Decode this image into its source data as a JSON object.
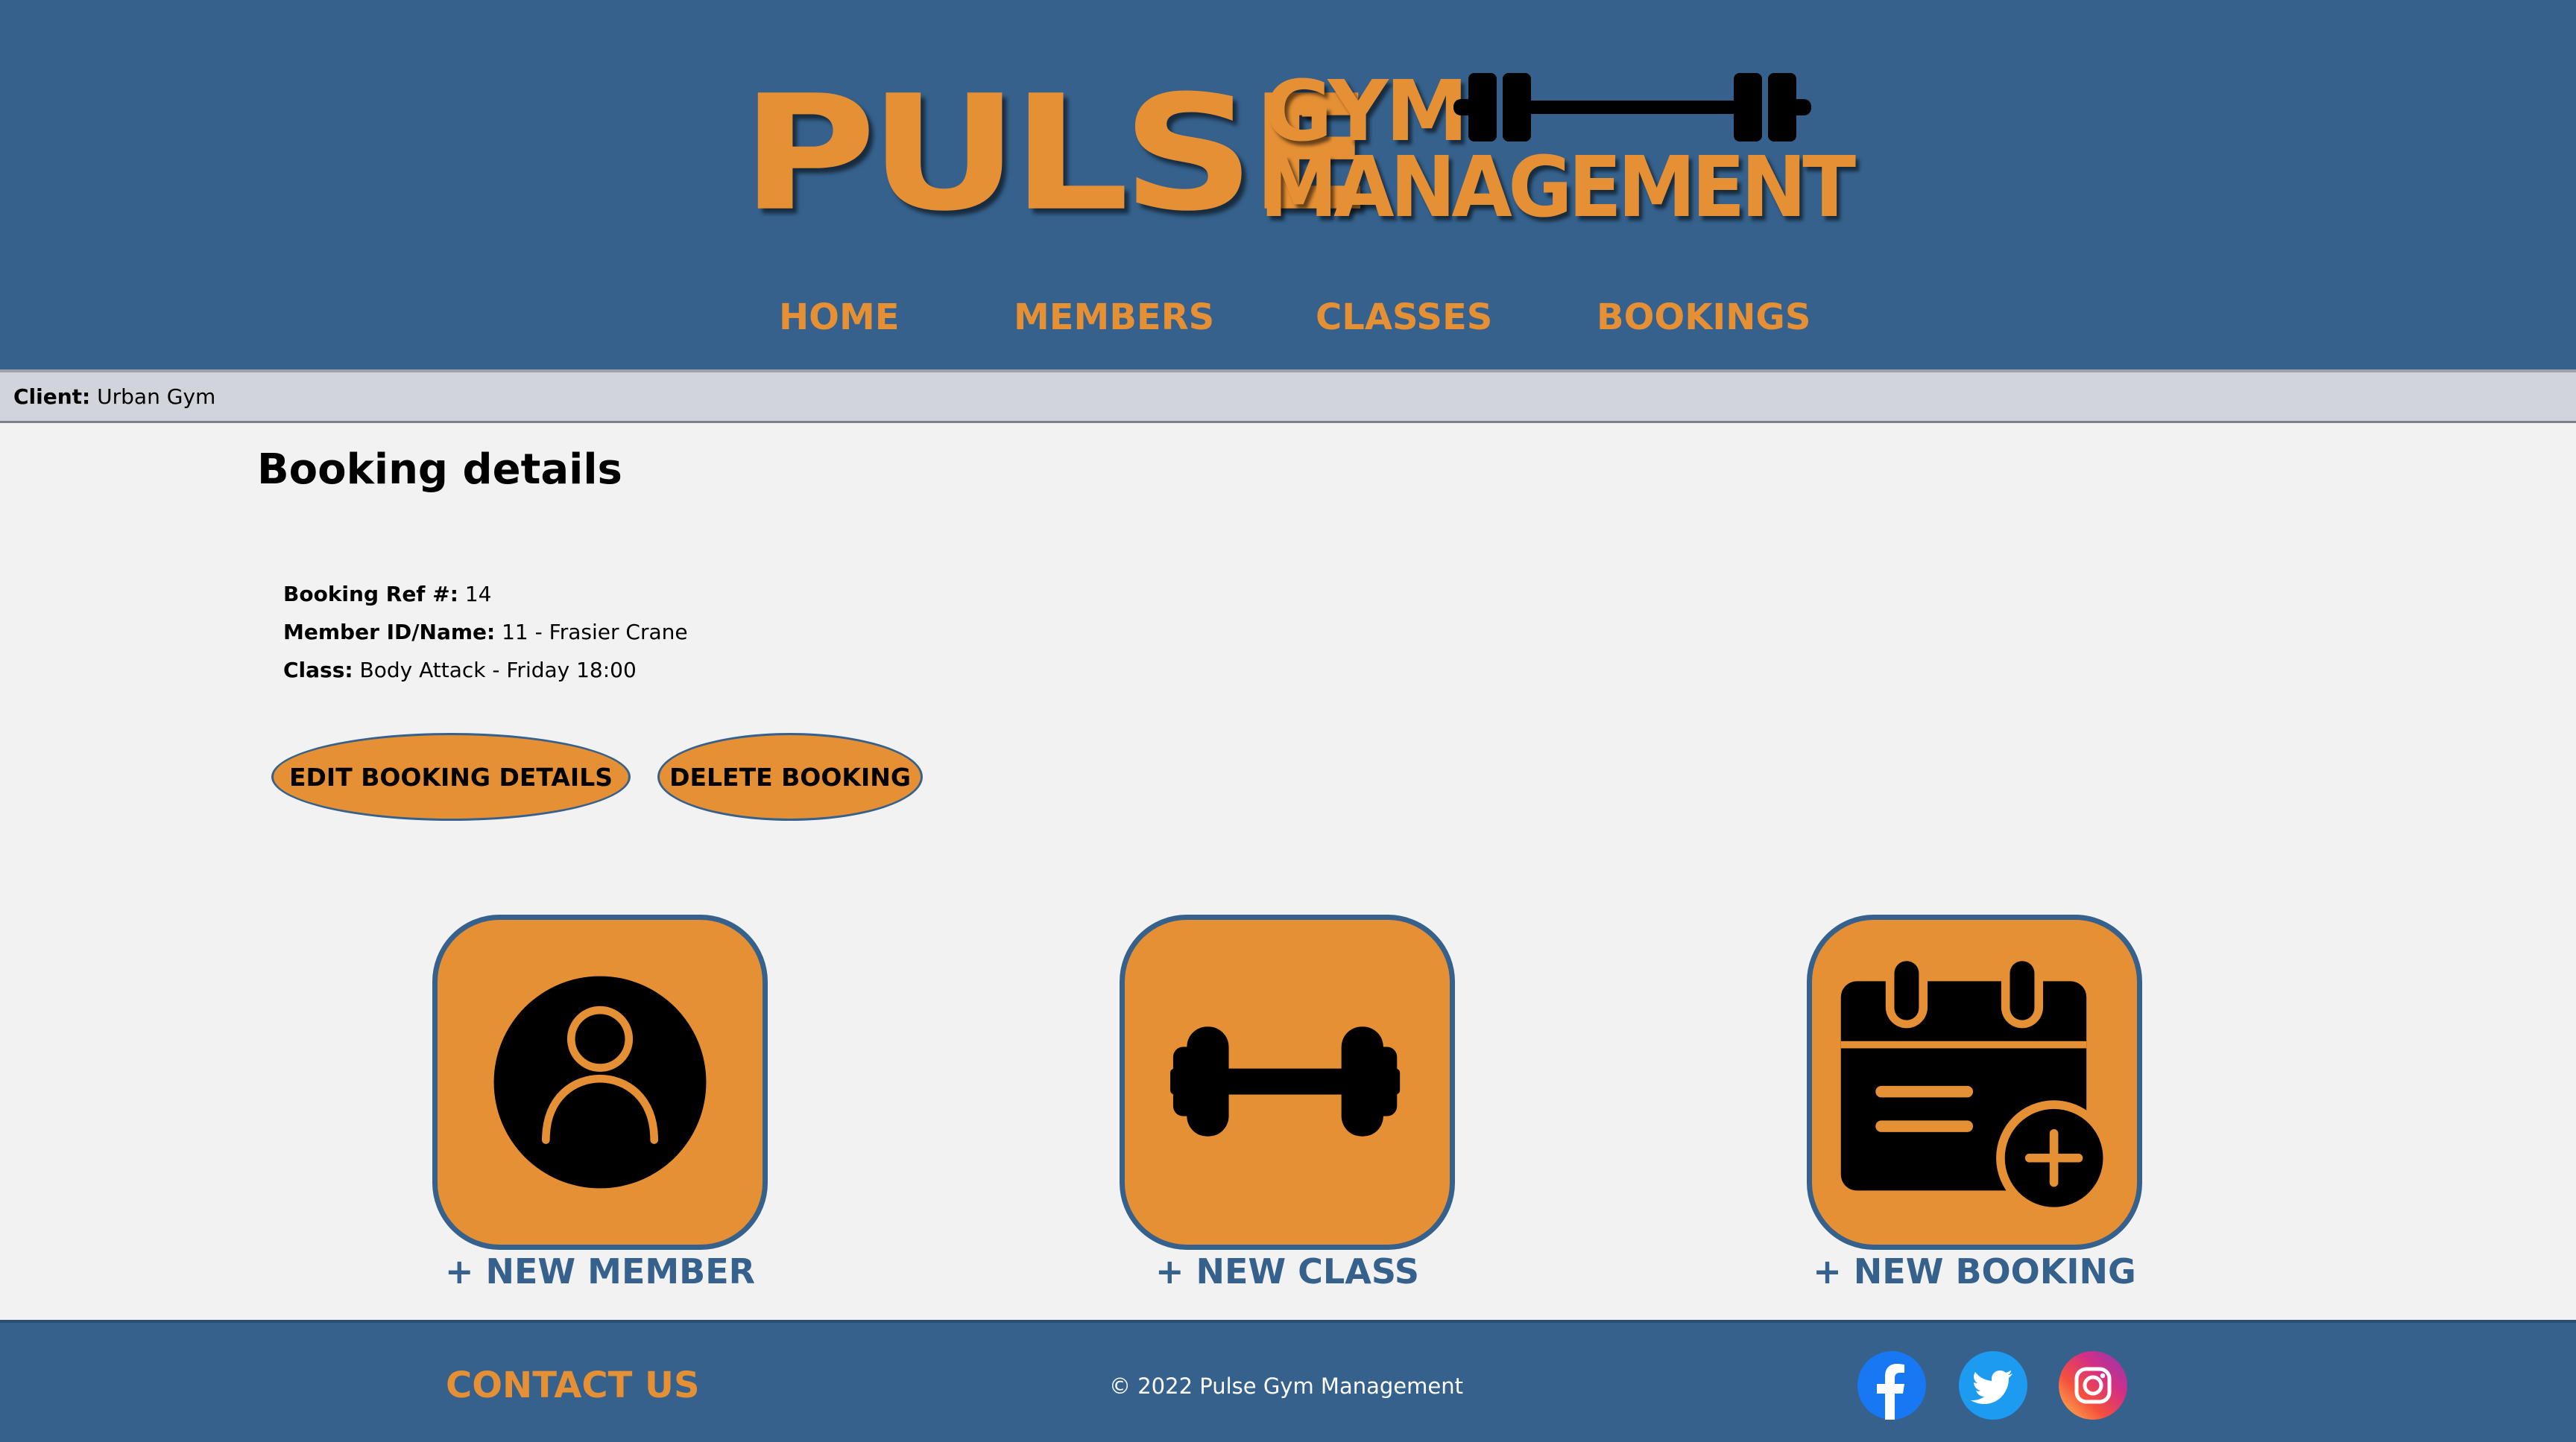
{
  "brand": {
    "logo_main": "PULSE",
    "logo_top": "GYM",
    "logo_bottom": "MANAGEMENT",
    "accent_color": "#e69035",
    "primary_color": "#35618c"
  },
  "nav": {
    "items": [
      {
        "label": "HOME"
      },
      {
        "label": "MEMBERS"
      },
      {
        "label": "CLASSES"
      },
      {
        "label": "BOOKINGS"
      }
    ]
  },
  "client": {
    "label": "Client:",
    "value": "Urban Gym"
  },
  "page": {
    "title": "Booking details"
  },
  "booking": {
    "ref_label": "Booking Ref #:",
    "ref_value": "14",
    "member_label": "Member ID/Name:",
    "member_value": "11 - Frasier Crane",
    "class_label": "Class:",
    "class_value": "Body Attack - Friday 18:00"
  },
  "actions": {
    "edit_label": "EDIT BOOKING DETAILS",
    "delete_label": "DELETE BOOKING"
  },
  "quick_links": [
    {
      "label": "+ NEW MEMBER",
      "icon": "user-icon"
    },
    {
      "label": "+ NEW CLASS",
      "icon": "dumbbell-icon"
    },
    {
      "label": "+ NEW BOOKING",
      "icon": "calendar-add-icon"
    }
  ],
  "footer": {
    "contact_label": "CONTACT US",
    "copyright": "© 2022 Pulse Gym Management",
    "social": [
      {
        "icon": "facebook-icon"
      },
      {
        "icon": "twitter-icon"
      },
      {
        "icon": "instagram-icon"
      }
    ]
  }
}
